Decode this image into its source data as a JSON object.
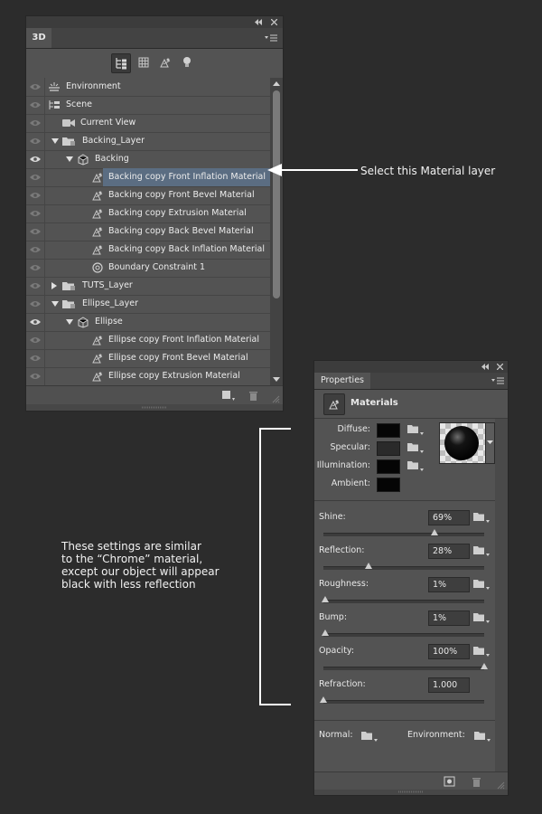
{
  "panel_3d": {
    "tab": "3D",
    "rows": [
      {
        "label": "Environment",
        "indent": 0,
        "icon": "environment-icon",
        "eye": "dim",
        "selected": false
      },
      {
        "label": "Scene",
        "indent": 0,
        "icon": "scene-icon",
        "eye": "dim",
        "selected": false
      },
      {
        "label": "Current View",
        "indent": 1,
        "icon": "camera-icon",
        "eye": "dim",
        "selected": false
      },
      {
        "label": "Backing_Layer",
        "indent": 0,
        "icon": "folder-icon",
        "eye": "dim",
        "arrow": "down",
        "selected": false
      },
      {
        "label": "Backing",
        "indent": 1,
        "icon": "mesh-icon",
        "eye": "on",
        "arrow": "down",
        "selected": false
      },
      {
        "label": "Backing copy Front Inflation Material",
        "indent": 2,
        "icon": "material-icon",
        "eye": "dim",
        "selected": true
      },
      {
        "label": "Backing copy Front Bevel Material",
        "indent": 2,
        "icon": "material-icon",
        "eye": "dim",
        "selected": false
      },
      {
        "label": "Backing copy Extrusion Material",
        "indent": 2,
        "icon": "material-icon",
        "eye": "dim",
        "selected": false
      },
      {
        "label": "Backing copy Back Bevel Material",
        "indent": 2,
        "icon": "material-icon",
        "eye": "dim",
        "selected": false
      },
      {
        "label": "Backing copy Back Inflation Material",
        "indent": 2,
        "icon": "material-icon",
        "eye": "dim",
        "selected": false
      },
      {
        "label": "Boundary Constraint 1",
        "indent": 2,
        "icon": "constraint-icon",
        "eye": "dim",
        "selected": false
      },
      {
        "label": "TUTS_Layer",
        "indent": 0,
        "icon": "folder-icon",
        "eye": "dim",
        "arrow": "right",
        "selected": false
      },
      {
        "label": "Ellipse_Layer",
        "indent": 0,
        "icon": "folder-icon",
        "eye": "dim",
        "arrow": "down",
        "selected": false
      },
      {
        "label": "Ellipse",
        "indent": 1,
        "icon": "mesh-icon",
        "eye": "on",
        "arrow": "down",
        "selected": false
      },
      {
        "label": "Ellipse copy Front Inflation Material",
        "indent": 2,
        "icon": "material-icon",
        "eye": "dim",
        "selected": false
      },
      {
        "label": "Ellipse copy Front Bevel Material",
        "indent": 2,
        "icon": "material-icon",
        "eye": "dim",
        "selected": false
      },
      {
        "label": "Ellipse copy Extrusion Material",
        "indent": 2,
        "icon": "material-icon",
        "eye": "dim",
        "selected": false
      }
    ]
  },
  "properties": {
    "tab": "Properties",
    "header": "Materials",
    "colors": [
      {
        "label": "Diffuse:",
        "swatch": "#050505"
      },
      {
        "label": "Specular:",
        "swatch": "#2a2a2a"
      },
      {
        "label": "Illumination:",
        "swatch": "#050505"
      },
      {
        "label": "Ambient:",
        "swatch": "#050505"
      }
    ],
    "sliders": [
      {
        "label": "Shine:",
        "value": "69%",
        "level": 0.69,
        "has_folder": true
      },
      {
        "label": "Reflection:",
        "value": "28%",
        "level": 0.28,
        "has_folder": true
      },
      {
        "label": "Roughness:",
        "value": "1%",
        "level": 0.01,
        "has_folder": true
      },
      {
        "label": "Bump:",
        "value": "1%",
        "level": 0.01,
        "has_folder": true
      },
      {
        "label": "Opacity:",
        "value": "100%",
        "level": 1.0,
        "has_folder": true
      },
      {
        "label": "Refraction:",
        "value": "1.000",
        "level": 0.0,
        "has_folder": false
      }
    ],
    "normal_label": "Normal:",
    "environment_label": "Environment:"
  },
  "annotations": {
    "select_layer": "Select this Material layer",
    "note_lines": [
      "These settings are similar",
      "to the “Chrome” material,",
      "except our object will appear",
      "black with less reflection"
    ]
  },
  "colors": {
    "background": "#2c2c2c",
    "panel": "#535353",
    "selection": "#5b6d82",
    "annotation": "#f2f2f2"
  }
}
